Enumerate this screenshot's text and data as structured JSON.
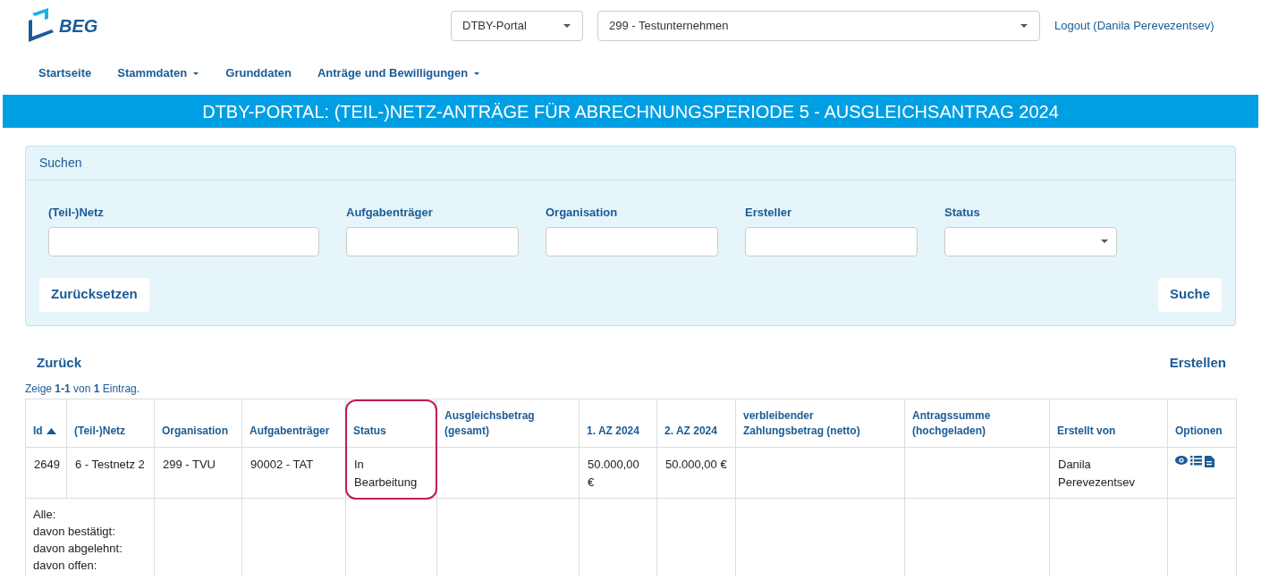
{
  "header": {
    "logo_text": "BEG",
    "portal_select": "DTBY-Portal",
    "company_select": "299 - Testunternehmen",
    "logout": "Logout (Danila Perevezentsev)"
  },
  "nav": [
    {
      "label": "Startseite",
      "dropdown": false
    },
    {
      "label": "Stammdaten",
      "dropdown": true
    },
    {
      "label": "Grunddaten",
      "dropdown": false
    },
    {
      "label": "Anträge und Bewilligungen",
      "dropdown": true
    }
  ],
  "page_title": "DTBY-PORTAL: (TEIL-)NETZ-ANTRÄGE FÜR ABRECHNUNGSPERIODE 5 - AUSGLEICHSANTRAG 2024",
  "search": {
    "title": "Suchen",
    "fields": [
      {
        "label": "(Teil-)Netz",
        "kind": "text"
      },
      {
        "label": "Aufgabenträger",
        "kind": "text"
      },
      {
        "label": "Organisation",
        "kind": "text"
      },
      {
        "label": "Ersteller",
        "kind": "text"
      },
      {
        "label": "Status",
        "kind": "select"
      }
    ],
    "reset": "Zurücksetzen",
    "submit": "Suche"
  },
  "back": "Zurück",
  "create": "Erstellen",
  "summary": "Zeige **1-1** von **1** Eintrag.",
  "table": {
    "columns": [
      {
        "label": "Id",
        "sorted": true,
        "highlighted": false
      },
      {
        "label": "(Teil-)Netz",
        "sorted": false,
        "highlighted": false
      },
      {
        "label": "Organisation",
        "sorted": false,
        "highlighted": false
      },
      {
        "label": "Aufgabenträger",
        "sorted": false,
        "highlighted": false
      },
      {
        "label": "Status",
        "sorted": false,
        "highlighted": true
      },
      {
        "label": "Ausgleichsbetrag (gesamt)",
        "sorted": false,
        "highlighted": false
      },
      {
        "label": "1. AZ 2024",
        "sorted": false,
        "highlighted": false
      },
      {
        "label": "2. AZ 2024",
        "sorted": false,
        "highlighted": false
      },
      {
        "label": "verbleibender Zahlungsbetrag (netto)",
        "sorted": false,
        "highlighted": false
      },
      {
        "label": "Antragssumme (hochgeladen)",
        "sorted": false,
        "highlighted": false
      },
      {
        "label": "Erstellt von",
        "sorted": false,
        "highlighted": false
      },
      {
        "label": "Optionen",
        "sorted": false,
        "highlighted": false
      }
    ],
    "rows": [
      {
        "cells": [
          "2649",
          "6 - Testnetz 2",
          "299 - TVU",
          "90002 - TAT",
          "In Bearbeitung",
          "",
          "50.000,00 €",
          "50.000,00 €",
          "",
          "",
          "Danila Perevezentsev"
        ]
      }
    ],
    "totals": [
      "Alle:",
      "davon bestätigt:",
      "davon abgelehnt:",
      "davon offen:"
    ]
  }
}
